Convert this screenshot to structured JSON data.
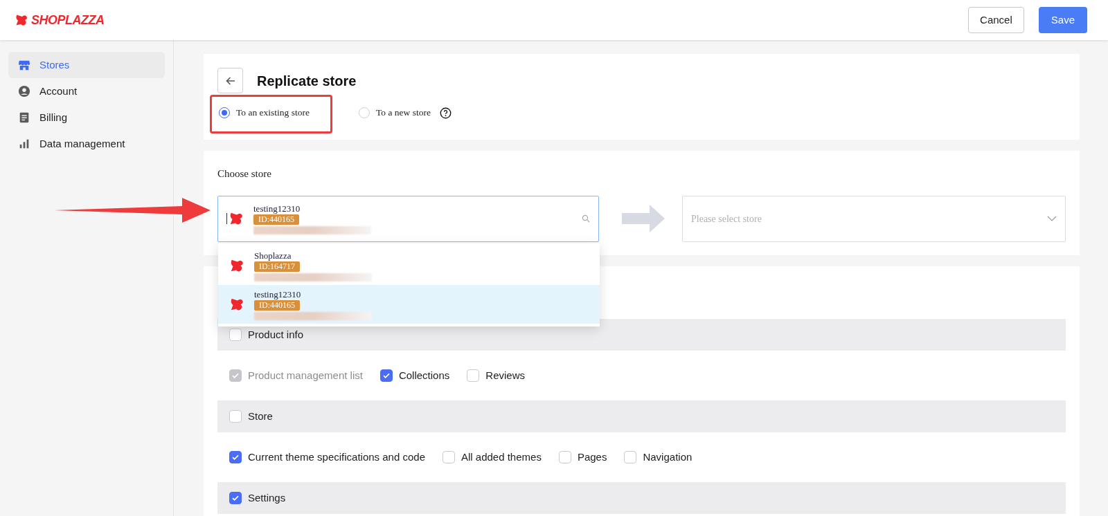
{
  "header": {
    "logo": "SHOPLAZZA",
    "buttons": [
      {
        "label": "Cancel",
        "kind": "secondary"
      },
      {
        "label": "Save",
        "kind": "primary"
      }
    ]
  },
  "sidebar": {
    "items": [
      {
        "label": "Stores",
        "selected": true
      },
      {
        "label": "Account",
        "selected": false
      },
      {
        "label": "Billing",
        "selected": false
      },
      {
        "label": "Data management",
        "selected": false
      }
    ]
  },
  "page": {
    "title": "Replicate store",
    "radios": [
      {
        "label": "To an existing store",
        "selected": true
      },
      {
        "label": "To a new store",
        "selected": false,
        "help": true
      }
    ]
  },
  "choose_store": {
    "label": "Choose store",
    "source": {
      "name": "testing12310",
      "id": "ID:440165"
    },
    "options": [
      {
        "name": "Shoplazza",
        "id": "ID:164717",
        "selected": false
      },
      {
        "name": "testing12310",
        "id": "ID:440165",
        "selected": true
      }
    ],
    "target": {
      "placeholder": "Please select store"
    }
  },
  "sections": [
    {
      "label": "Product info",
      "checked": false,
      "options": [
        {
          "label": "Product management list",
          "checked": true,
          "disabled": true
        },
        {
          "label": "Collections",
          "checked": true
        },
        {
          "label": "Reviews",
          "checked": false
        }
      ]
    },
    {
      "label": "Store",
      "checked": false,
      "options": [
        {
          "label": "Current theme specifications and code",
          "checked": true
        },
        {
          "label": "All added themes",
          "checked": false
        },
        {
          "label": "Pages",
          "checked": false
        },
        {
          "label": "Navigation",
          "checked": false
        }
      ]
    },
    {
      "label": "Settings",
      "checked": true
    }
  ]
}
